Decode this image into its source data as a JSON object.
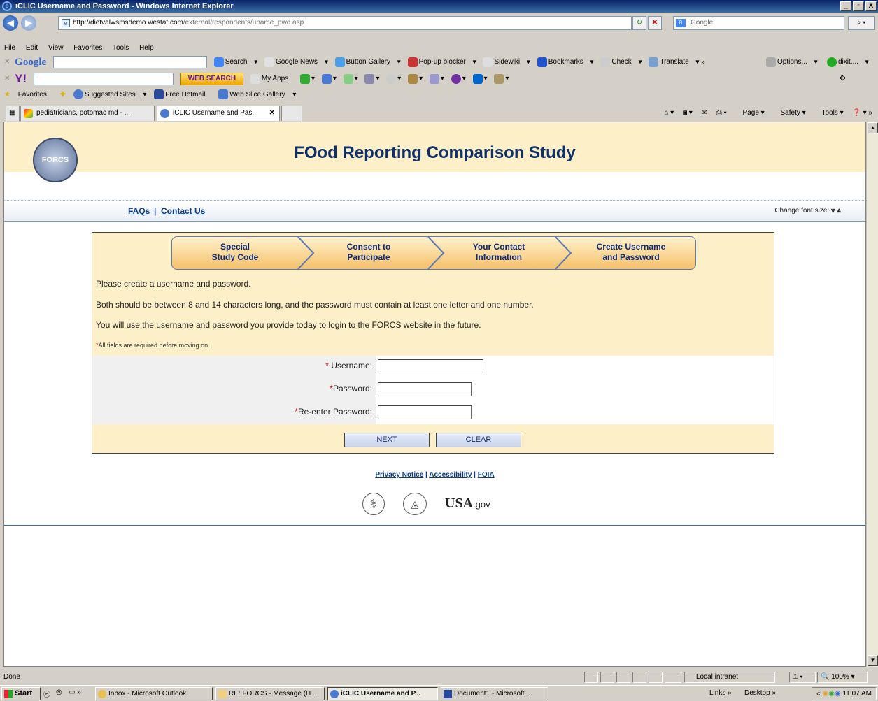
{
  "window": {
    "title": "iCLIC Username and Password - Windows Internet Explorer",
    "buttons": [
      "_",
      "▫",
      "X"
    ]
  },
  "address": {
    "url_host": "http://dietvalwsmsdemo.westat.com",
    "url_path": "/external/respondents/uname_pwd.asp",
    "search_placeholder": "Google"
  },
  "menu": [
    "File",
    "Edit",
    "View",
    "Favorites",
    "Tools",
    "Help"
  ],
  "google_bar": {
    "logo": "Google",
    "items": [
      "Search",
      "Google News",
      "Button Gallery",
      "Pop-up blocker",
      "Sidewiki",
      "Bookmarks",
      "Check",
      "Translate",
      "Options...",
      "dixit...."
    ]
  },
  "yahoo_bar": {
    "logo": "Y!",
    "web_search": "WEB SEARCH",
    "my_apps": "My Apps"
  },
  "favorites_bar": {
    "favorites": "Favorites",
    "items": [
      "Suggested Sites",
      "Free Hotmail",
      "Web Slice Gallery"
    ]
  },
  "tabs": [
    {
      "label": "pediatricians, potomac md - ..."
    },
    {
      "label": "iCLIC Username and Pas..."
    }
  ],
  "command_bar": [
    "Page",
    "Safety",
    "Tools"
  ],
  "page": {
    "title": "FOod Reporting Comparison Study",
    "logo_text": "FORCS",
    "links": {
      "faqs": "FAQs",
      "separator": "|",
      "contact": "Contact Us"
    },
    "font_size_label": "Change font size:",
    "steps": [
      {
        "line1": "Special",
        "line2": "Study Code"
      },
      {
        "line1": "Consent to",
        "line2": "Participate"
      },
      {
        "line1": "Your Contact",
        "line2": "Information"
      },
      {
        "line1": "Create Username",
        "line2": "and Password"
      }
    ],
    "instructions": [
      "Please create a username and password.",
      "Both should be between 8 and 14 characters long, and the password must contain at least one letter and one number.",
      "You will use the username and password you provide today to login to the FORCS website in the future."
    ],
    "required_note": "All fields are required before moving on.",
    "form": {
      "username_label": "Username:",
      "password_label": "Password:",
      "reenter_label": "Re-enter Password:",
      "username_value": "",
      "password_value": "",
      "reenter_value": ""
    },
    "buttons": {
      "next": "NEXT",
      "clear": "CLEAR"
    },
    "footer": {
      "privacy": "Privacy Notice",
      "accessibility": "Accessibility",
      "foia": "FOIA",
      "usa": "USA",
      "gov": ".gov"
    }
  },
  "status_bar": {
    "text": "Done",
    "zone": "Local intranet",
    "zoom": "100%"
  },
  "taskbar": {
    "start": "Start",
    "items": [
      "Inbox - Microsoft Outlook",
      "RE: FORCS - Message (H...",
      "iCLIC Username and P...",
      "Document1 - Microsoft ..."
    ],
    "tray": {
      "links": "Links",
      "desktop": "Desktop",
      "time": "11:07 AM"
    }
  }
}
